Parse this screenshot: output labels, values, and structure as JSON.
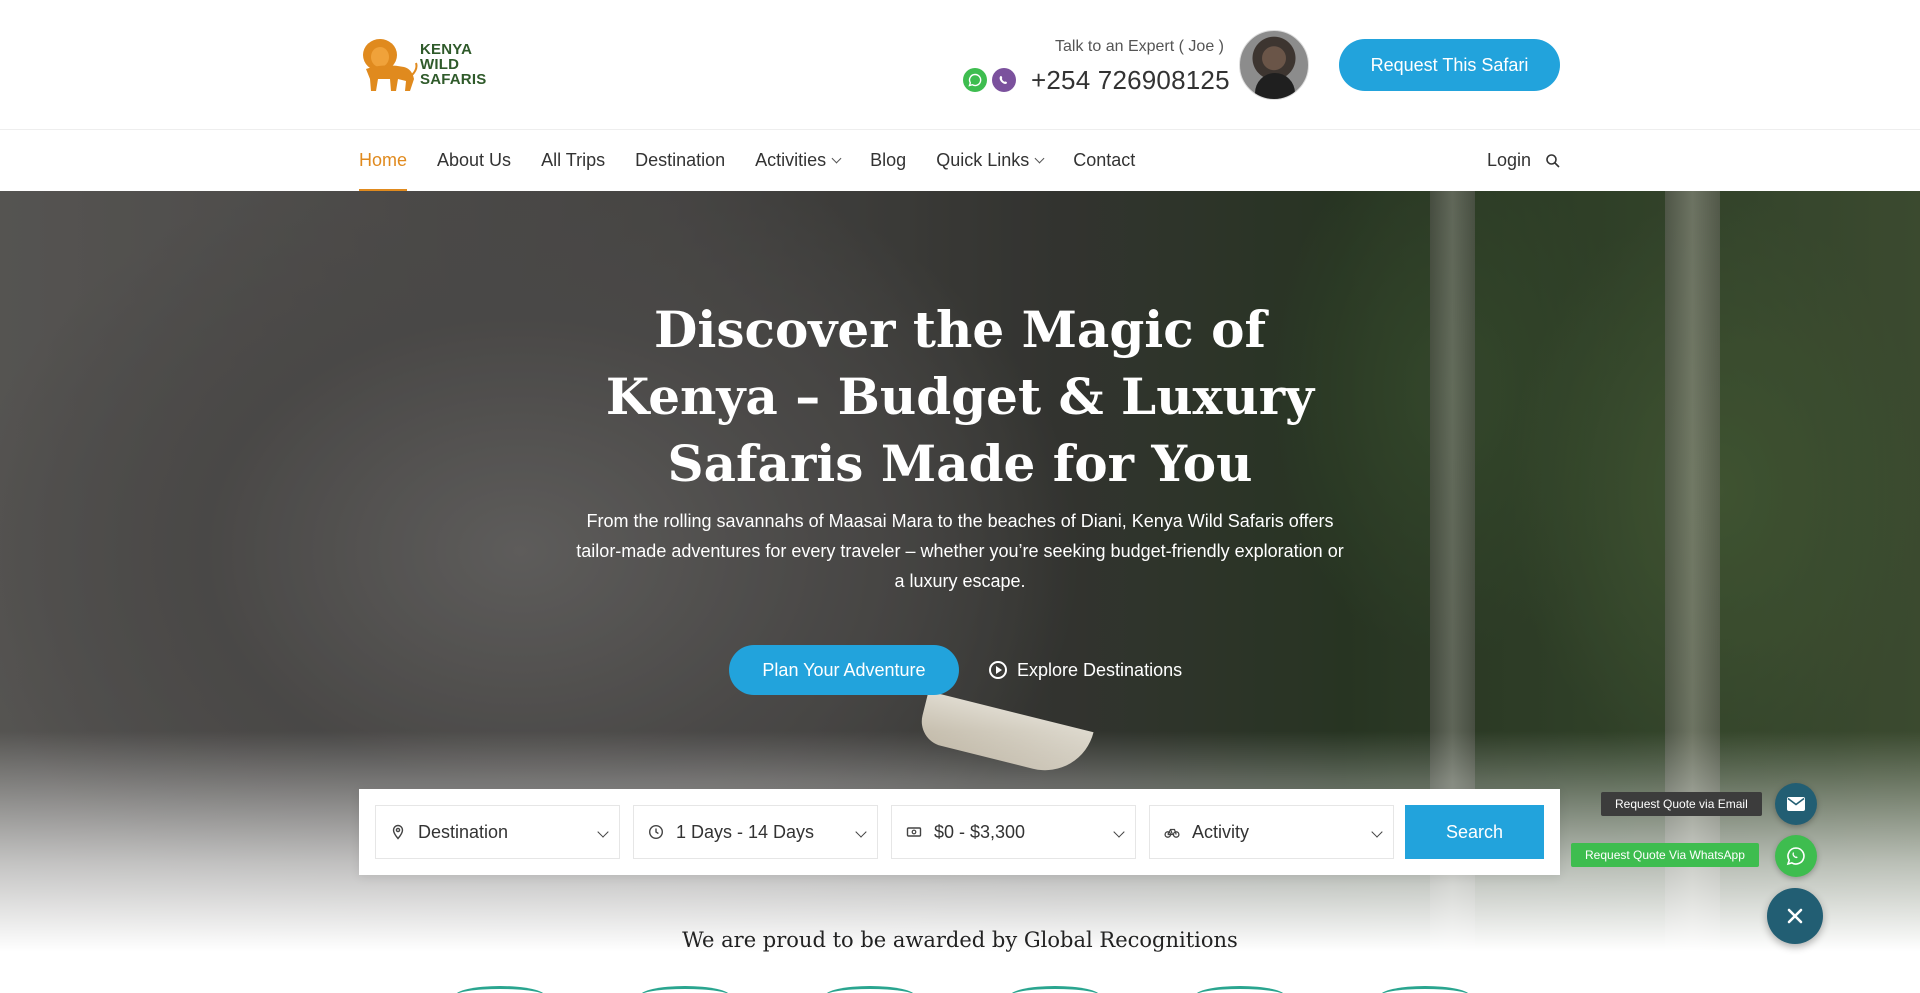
{
  "brand": {
    "line1": "KENYA",
    "line2": "WILD",
    "line3": "SAFARIS",
    "accent": "#e08a1e",
    "primary": "#22a3dc"
  },
  "header": {
    "expert_label": "Talk to an Expert ( Joe )",
    "phone": "+254 726908125",
    "request_button": "Request This Safari"
  },
  "nav": {
    "items": [
      {
        "label": "Home",
        "active": true
      },
      {
        "label": "About Us"
      },
      {
        "label": "All Trips"
      },
      {
        "label": "Destination"
      },
      {
        "label": "Activities",
        "dropdown": true
      },
      {
        "label": "Blog"
      },
      {
        "label": "Quick Links",
        "dropdown": true
      },
      {
        "label": "Contact"
      }
    ],
    "login": "Login"
  },
  "hero": {
    "title": "Discover the Magic of Kenya – Budget & Luxury Safaris Made for You",
    "subtitle": "From the rolling savannahs of Maasai Mara to the beaches of Diani, Kenya Wild Safaris offers tailor-made adventures for every traveler – whether you’re seeking budget-friendly exploration or a luxury escape.",
    "primary_button": "Plan Your Adventure",
    "secondary_button": "Explore Destinations"
  },
  "search": {
    "destination": "Destination",
    "duration": "1 Days - 14 Days",
    "price": "$0 - $3,300",
    "activity": "Activity",
    "button": "Search"
  },
  "awards": {
    "title": "We are proud to be awarded by Global Recognitions"
  },
  "floating": {
    "email_label": "Request Quote via Email",
    "whatsapp_label": "Request Quote Via WhatsApp"
  }
}
